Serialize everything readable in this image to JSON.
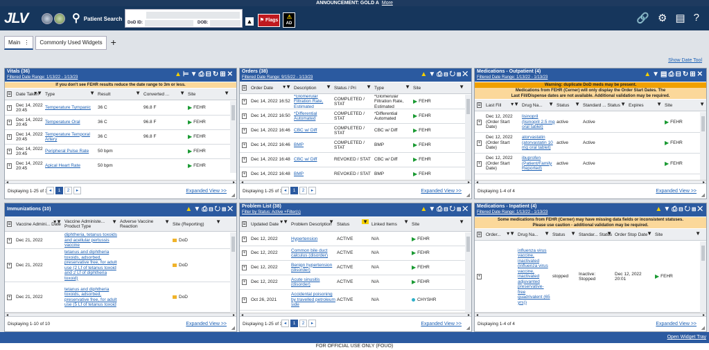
{
  "announcement": {
    "text": "ANNOUNCEMENT: GOLD A",
    "more": "More"
  },
  "header": {
    "logo": "JLV",
    "patient_search": "Patient Search",
    "dod_id_label": "DoD ID:",
    "dob_label": "DOB:",
    "flags": "Flags",
    "ad": "AD",
    "icons": [
      "link-icon",
      "gear-icon",
      "document-icon",
      "help-icon",
      "exit-icon"
    ]
  },
  "tabs": [
    {
      "label": "Main"
    },
    {
      "label": "Commonly Used Widgets"
    }
  ],
  "show_date_tool": "Show Date Tool",
  "widgets": {
    "vitals": {
      "title": "Vitals (36)",
      "subtitle": "Filtered Date Range: 1/13/22 - 1/13/23",
      "banner": "If you don't see FEHR results reduce the date range to 3m or less.",
      "headers": [
        "Date Taken",
        "Type",
        "Result",
        "Converted ...",
        "Site"
      ],
      "rows": [
        [
          "Dec 14, 2022 20:45",
          "Temperature Tympanic",
          "36 C",
          "96.8 F",
          "FEHR"
        ],
        [
          "Dec 14, 2022 20:45",
          "Temperature Oral",
          "36 C",
          "96.8 F",
          "FEHR"
        ],
        [
          "Dec 14, 2022 20:45",
          "Temperature Temporal Artery",
          "36 C",
          "96.8 F",
          "FEHR"
        ],
        [
          "Dec 14, 2022 20:45",
          "Peripheral Pulse Rate",
          "50 bpm",
          "",
          "FEHR"
        ],
        [
          "Dec 14, 2022 20:45",
          "Apical Heart Rate",
          "50 bpm",
          "",
          "FEHR"
        ]
      ],
      "displaying": "Displaying 1-25 of 36",
      "pages": [
        "1",
        "2"
      ],
      "expanded": "Expanded View >>"
    },
    "orders": {
      "title": "Orders (38)",
      "subtitle": "Filtered Date Range: 9/15/22 - 1/13/23",
      "headers": [
        "Order Date",
        "Description",
        "Status / Pri",
        "Type",
        "Site"
      ],
      "rows": [
        [
          "Dec 14, 2022 16:52",
          "*Glomerular Filtration Rate, Estimated",
          "COMPLETED / STAT",
          "*Glomerular Filtration Rate, Estimated",
          "FEHR"
        ],
        [
          "Dec 14, 2022 16:50",
          "*Differential Automated",
          "COMPLETED / STAT",
          "*Differential Automated",
          "FEHR"
        ],
        [
          "Dec 14, 2022 16:46",
          "CBC w/ Diff",
          "COMPLETED / STAT",
          "CBC w/ Diff",
          "FEHR"
        ],
        [
          "Dec 14, 2022 16:46",
          "BMP",
          "COMPLETED / STAT",
          "BMP",
          "FEHR"
        ],
        [
          "Dec 14, 2022 16:48",
          "CBC w/ Diff",
          "REVOKED / STAT",
          "CBC w/ Diff",
          "FEHR"
        ],
        [
          "Dec 14, 2022 16:48",
          "BMP",
          "REVOKED / STAT",
          "BMP",
          "FEHR"
        ]
      ],
      "displaying": "Displaying 1-25 of 38",
      "pages": [
        "1",
        "2"
      ],
      "expanded": "Expanded View >>"
    },
    "medout": {
      "title": "Medications - Outpatient (4)",
      "subtitle": "Filtered Date Range: 1/13/22 - 1/13/23",
      "banner1": "Warning: duplicate DoD meds may be present.",
      "banner2a": "Medications from FEHR (Cerner) will only display the Order Start Dates. The",
      "banner2b": "Last Fill/Dispense dates are not available. Additional validation may be required.",
      "headers": [
        "Last Fill",
        "Drug Na...",
        "Status",
        "Standard ... Status",
        "Expires",
        "Site"
      ],
      "rows": [
        [
          "Dec 12, 2022",
          "(Order Start Date)",
          "lisinopril (lisinopril 2.5 mg oral tablet)",
          "active",
          "Active",
          "",
          "FEHR"
        ],
        [
          "Dec 12, 2022",
          "(Order Start Date)",
          "atorvastatin (atorvastatin 10 mg oral tablet)",
          "active",
          "Active",
          "",
          "FEHR"
        ],
        [
          "Dec 12, 2022",
          "(Order Start Date)",
          "ibuprofen (Patient/Family Reported)",
          "active",
          "Active",
          "",
          "FEHR"
        ]
      ],
      "displaying": "Displaying 1-4 of 4",
      "expanded": "Expanded View >>"
    },
    "immun": {
      "title": "Immunizations (10)",
      "headers": [
        "Vaccine Admini... Date",
        "Vaccine Administe... Product Type",
        "Adverse Vaccine Reaction",
        "Site (Reporting)"
      ],
      "rows": [
        [
          "Dec 21, 2022",
          "diphtheria, tetanus toxoids and acellular pertussis vaccine",
          "",
          "DoD"
        ],
        [
          "Dec 21, 2022",
          "tetanus and diphtheria toxoids, adsorbed, preservative free, for adult use (2 Lf of tetanus toxoid and 2 Lf of diphtheria toxoid)",
          "",
          "DoD"
        ],
        [
          "Dec 21, 2022",
          "tetanus and diphtheria toxoids, adsorbed, preservative free, for adult use (5 Lf of tetanus toxoid",
          "",
          "DoD"
        ]
      ],
      "displaying": "Displaying 1-10 of 10",
      "expanded": "Expanded View >>"
    },
    "problems": {
      "title": "Problem List (38)",
      "subtitle": "Filter by Status: Active",
      "filters": "+Filter(s)",
      "headers": [
        "Updated Date",
        "Problem Description",
        "Status",
        "Linked Items",
        "Site"
      ],
      "rows": [
        [
          "Dec 12, 2022",
          "Hypertension",
          "ACTIVE",
          "N/A",
          "FEHR"
        ],
        [
          "Dec 12, 2022",
          "Common bile duct calculus (disorder)",
          "ACTIVE",
          "N/A",
          "FEHR"
        ],
        [
          "Dec 12, 2022",
          "Benign hypertension (disorder)",
          "ACTIVE",
          "N/A",
          "FEHR"
        ],
        [
          "Dec 12, 2022",
          "Acute sinusitis (disorder)",
          "ACTIVE",
          "N/A",
          "FEHR"
        ],
        [
          "Oct 26, 2021",
          "Accidental poisoning by travelled petroleum side",
          "ACTIVE",
          "N/A",
          "CHYSHR"
        ]
      ],
      "displaying": "Displaying 1-25 of 38",
      "pages": [
        "1",
        "2"
      ],
      "expanded": "Expanded View >>"
    },
    "medin": {
      "title": "Medications - Inpatient (4)",
      "subtitle": "Filtered Date Range: 1/13/22 - 1/13/23",
      "banner1": "Some medications from FEHR (Cerner) may have missing data fields or inconsistent statuses.",
      "banner2": "Please use caution - additional validation may be required.",
      "headers": [
        "Order...",
        "Drug Na...",
        "Status",
        "Standar... Status",
        "Order Stop Date",
        "Site"
      ],
      "rows": [
        [
          "",
          "influenza virus vaccine, inactivated (influenza virus vaccine, inactivated adjuvanted preservative-free quadrivalent (65 yrs))",
          "stopped",
          "Inactive: Stopped",
          "Dec 12, 2022 20:01",
          "FEHR"
        ]
      ],
      "displaying": "Displaying 1-4 of 4",
      "expanded": "Expanded View >>"
    }
  },
  "open_widget_tray": "Open Widget Tray",
  "footer": "FOR OFFICIAL USE ONLY (FOUO)"
}
